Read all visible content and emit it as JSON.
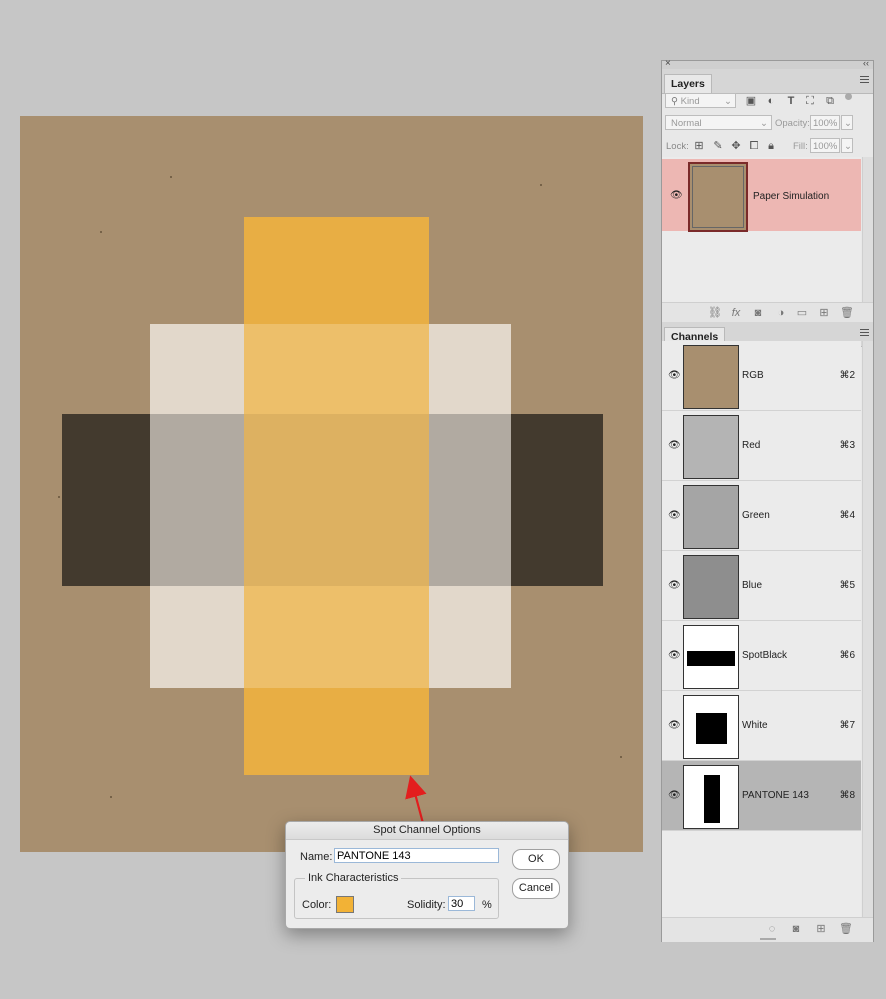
{
  "layers_panel": {
    "tab_label": "Layers",
    "filter_kind": "Kind",
    "blend_mode": "Normal",
    "opacity_label": "Opacity:",
    "opacity_value": "100%",
    "lock_label": "Lock:",
    "fill_label": "Fill:",
    "fill_value": "100%",
    "layers": [
      {
        "name": "Paper Simulation",
        "visible": true,
        "selected": true
      }
    ],
    "footer_icons": [
      "link-icon",
      "fx-icon",
      "mask-icon",
      "adjustment-icon",
      "folder-icon",
      "new-layer-icon",
      "trash-icon"
    ]
  },
  "channels_panel": {
    "tab_label": "Channels",
    "channels": [
      {
        "name": "RGB",
        "shortcut": "⌘2"
      },
      {
        "name": "Red",
        "shortcut": "⌘3"
      },
      {
        "name": "Green",
        "shortcut": "⌘4"
      },
      {
        "name": "Blue",
        "shortcut": "⌘5"
      },
      {
        "name": "SpotBlack",
        "shortcut": "⌘6"
      },
      {
        "name": "White",
        "shortcut": "⌘7"
      },
      {
        "name": "PANTONE 143",
        "shortcut": "⌘8",
        "selected": true
      }
    ],
    "footer_icons": [
      "load-selection-icon",
      "save-selection-icon",
      "new-channel-icon",
      "trash-icon"
    ]
  },
  "dialog": {
    "title": "Spot Channel Options",
    "name_label": "Name:",
    "name_value": "PANTONE 143",
    "ink_legend": "Ink Characteristics",
    "color_label": "Color:",
    "ink_color": "#f2b236",
    "solidity_label": "Solidity:",
    "solidity_value": "30",
    "percent": "%",
    "ok_label": "OK",
    "cancel_label": "Cancel"
  },
  "colors": {
    "paper": "#a88f6f",
    "spot_black": "#433a2e",
    "white_ink": "#e9e2d8",
    "pantone_143": "#f2b236",
    "annotation_red": "#e31e1e",
    "selected_layer": "#edb7b3"
  }
}
